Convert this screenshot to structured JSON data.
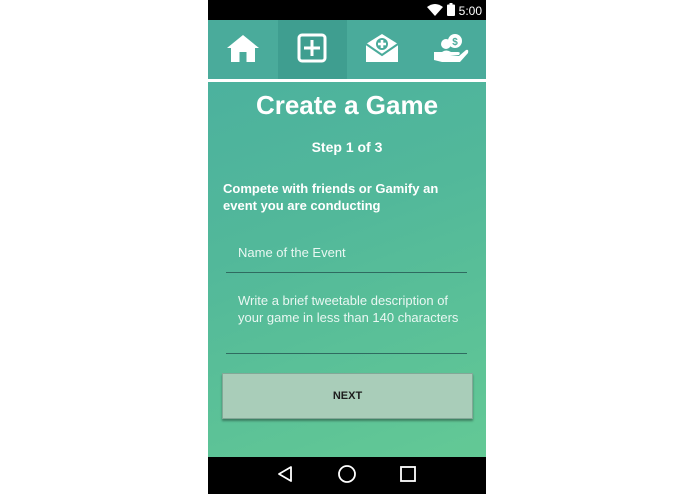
{
  "status_bar": {
    "time": "5:00",
    "icons": [
      "wifi-icon",
      "battery-icon"
    ]
  },
  "top_nav": {
    "items": [
      {
        "name": "home",
        "icon": "home-icon",
        "active": false
      },
      {
        "name": "create",
        "icon": "plus-square-icon",
        "active": true
      },
      {
        "name": "invites",
        "icon": "mail-plus-icon",
        "active": false
      },
      {
        "name": "rewards",
        "icon": "coin-hand-icon",
        "active": false
      }
    ]
  },
  "page": {
    "title": "Create a Game",
    "step": "Step 1 of 3",
    "intro": "Compete with friends or Gamify an event you are conducting"
  },
  "form": {
    "event_name_placeholder": "Name of the Event",
    "description_placeholder": "Write a brief tweetable description of your game in less than 140 characters",
    "next_label": "NEXT"
  },
  "system_nav": {
    "icons": [
      "back-icon",
      "home-circle-icon",
      "recents-icon"
    ]
  },
  "colors": {
    "gradient_top": "#4aaf9f",
    "gradient_bottom": "#63c995",
    "nav_active": "#3f9e90",
    "button": "#a9cdb9"
  }
}
